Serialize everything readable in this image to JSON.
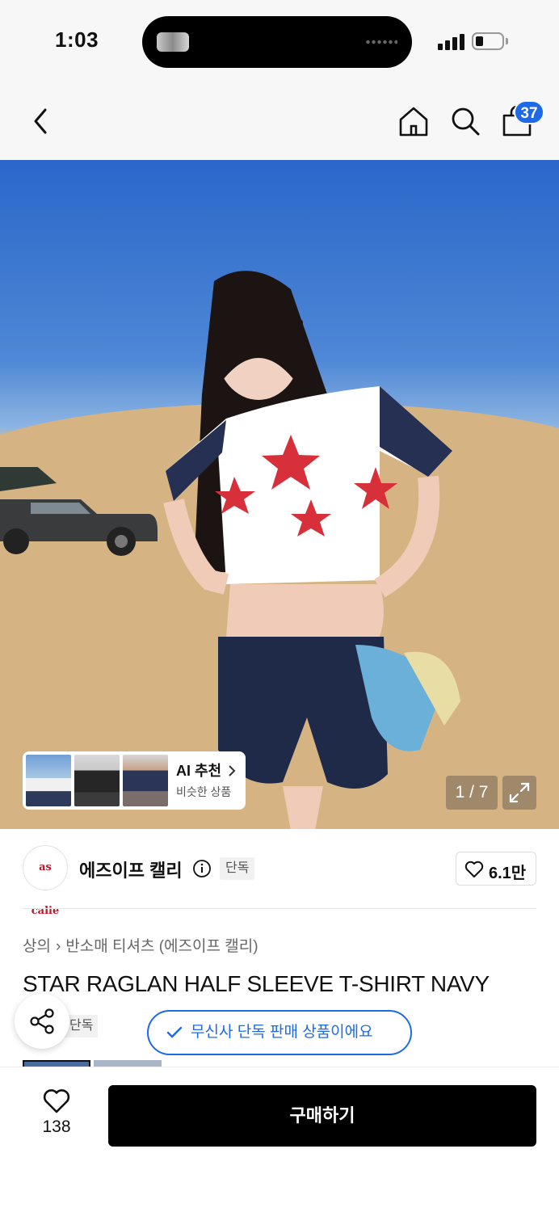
{
  "status_bar": {
    "time": "1:03"
  },
  "nav": {
    "cart_count": "37"
  },
  "hero": {
    "counter": "1 / 7",
    "ai_title": "AI 추천",
    "ai_subtitle": "비슷한 상품"
  },
  "brand": {
    "logo_text": "as calie",
    "name": "에즈이프 캘리",
    "exclusive_tag": "단독",
    "like_count": "6.1만"
  },
  "breadcrumb": {
    "level1": "상의",
    "level2": "반소매 티셔츠 (에즈이프 캘리)"
  },
  "product": {
    "title": "STAR RAGLAN HALF SLEEVE T-SHIRT NAVY",
    "exclusive_tag": "단독",
    "exclusive_pill": "무신사 단독 판매 상품이에요"
  },
  "bottom_bar": {
    "wish_count": "138",
    "buy_label": "구매하기"
  },
  "colors": {
    "accent": "#1e6ae6",
    "buy_button": "#000000"
  },
  "icons": [
    "back-icon",
    "home-icon",
    "search-icon",
    "cart-icon",
    "info-icon",
    "heart-icon",
    "share-icon",
    "check-icon",
    "expand-icon"
  ]
}
